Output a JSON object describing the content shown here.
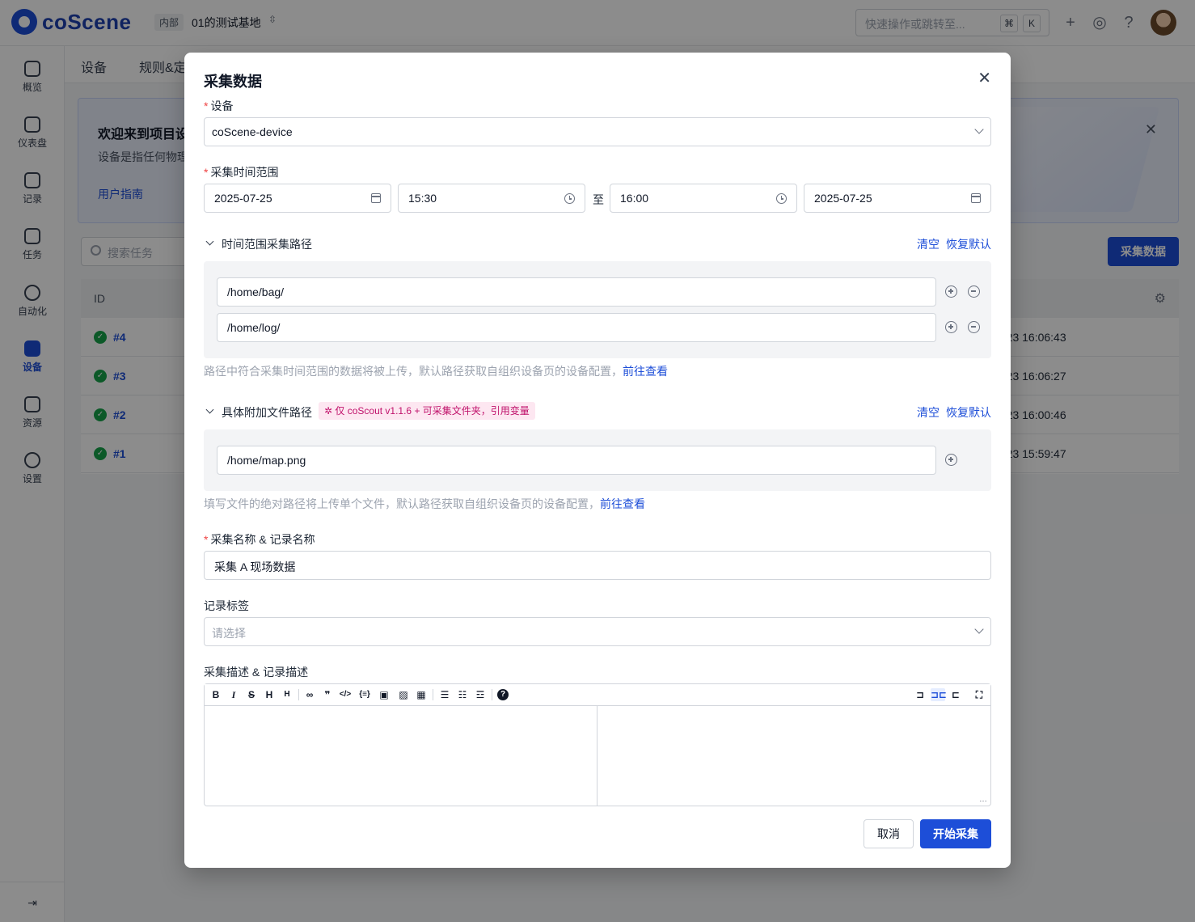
{
  "app": {
    "brand": "coScene",
    "org_badge": "内部",
    "org_name": "01的测试基地",
    "quick_search_placeholder": "快速操作或跳转至...",
    "kbd_cmd": "⌘",
    "kbd_k": "K"
  },
  "sidebar": {
    "items": [
      {
        "label": "概览"
      },
      {
        "label": "仪表盘"
      },
      {
        "label": "记录"
      },
      {
        "label": "任务"
      },
      {
        "label": "自动化"
      },
      {
        "label": "设备"
      },
      {
        "label": "资源"
      },
      {
        "label": "设置"
      }
    ],
    "collapse_icon": "collapse-sidebar-icon"
  },
  "main": {
    "tabs": [
      {
        "label": "设备"
      },
      {
        "label": "规则&定"
      }
    ],
    "welcome": {
      "title": "欢迎来到项目设",
      "desc": "设备是指任何物理",
      "link": "用户指南"
    },
    "search_placeholder": "搜索任务",
    "primary_button": "采集数据",
    "table": {
      "header_id": "ID",
      "rows": [
        {
          "id": "#4",
          "time": "-23 16:06:43"
        },
        {
          "id": "#3",
          "time": "-23 16:06:27"
        },
        {
          "id": "#2",
          "time": "-23 16:00:46"
        },
        {
          "id": "#1",
          "time": "-23 15:59:47"
        }
      ]
    }
  },
  "modal": {
    "title": "采集数据",
    "device": {
      "label": "设备",
      "value": "coScene-device"
    },
    "time_range": {
      "label": "采集时间范围",
      "start_date": "2025-07-25",
      "start_time": "15:30",
      "separator": "至",
      "end_time": "16:00",
      "end_date": "2025-07-25"
    },
    "range_paths": {
      "title": "时间范围采集路径",
      "clear": "清空",
      "restore": "恢复默认",
      "paths": [
        "/home/bag/",
        "/home/log/"
      ],
      "hint": "路径中符合采集时间范围的数据将被上传，默认路径获取自组织设备页的设备配置，",
      "hint_link": "前往查看"
    },
    "file_paths": {
      "title": "具体附加文件路径",
      "tag": "仅 coScout v1.1.6 + 可采集文件夹，引用变量",
      "clear": "清空",
      "restore": "恢复默认",
      "paths": [
        "/home/map.png"
      ],
      "hint": "填写文件的绝对路径将上传单个文件，默认路径获取自组织设备页的设备配置，",
      "hint_link": "前往查看"
    },
    "name": {
      "label": "采集名称 & 记录名称",
      "value": "采集 A 现场数据"
    },
    "labels": {
      "label": "记录标签",
      "placeholder": "请选择"
    },
    "description": {
      "label": "采集描述 & 记录描述",
      "value": ""
    },
    "toolbar": {
      "bold": "B",
      "italic": "I",
      "strike": "S",
      "h_label": "H",
      "h_small": "H",
      "quote": "❞",
      "code": "</>",
      "table": "▦",
      "help": "?"
    },
    "cancel": "取消",
    "submit": "开始采集"
  },
  "colors": {
    "accent": "#1d4ed8",
    "required": "#ef4444",
    "tag_bg": "#fde7f1",
    "tag_text": "#c0126b",
    "success": "#16a34a"
  }
}
